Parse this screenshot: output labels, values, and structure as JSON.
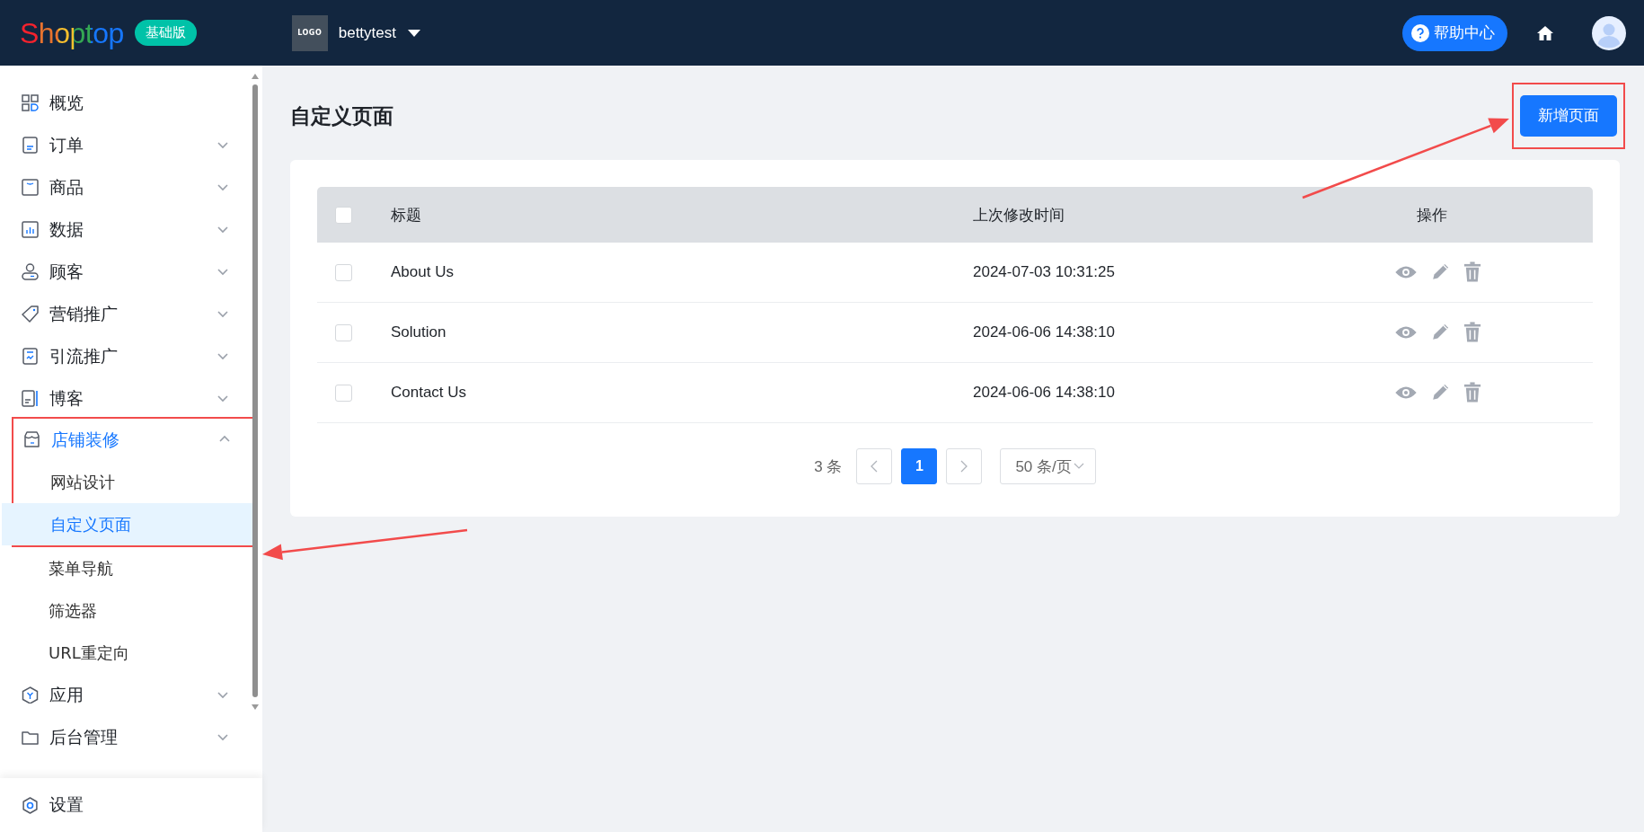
{
  "header": {
    "brand": "Shoptop",
    "plan_badge": "基础版",
    "store": {
      "logo_text": "LOGO",
      "name": "bettytest"
    },
    "help_button": "帮助中心"
  },
  "sidebar": {
    "items": [
      {
        "label": "概览",
        "kind": "link",
        "selected": false
      },
      {
        "label": "订单",
        "kind": "group",
        "expanded": false,
        "selected": false
      },
      {
        "label": "商品",
        "kind": "group",
        "expanded": false,
        "selected": false
      },
      {
        "label": "数据",
        "kind": "group",
        "expanded": false,
        "selected": false
      },
      {
        "label": "顾客",
        "kind": "group",
        "expanded": false,
        "selected": false
      },
      {
        "label": "营销推广",
        "kind": "group",
        "expanded": false,
        "selected": false
      },
      {
        "label": "引流推广",
        "kind": "group",
        "expanded": false,
        "selected": false
      },
      {
        "label": "博客",
        "kind": "group",
        "expanded": false,
        "selected": false
      },
      {
        "label": "店铺装修",
        "kind": "group",
        "expanded": true,
        "selected": true,
        "highlighted": true,
        "children": [
          {
            "label": "网站设计",
            "selected": false
          },
          {
            "label": "自定义页面",
            "selected": true
          },
          {
            "label": "菜单导航",
            "selected": false
          },
          {
            "label": "筛选器",
            "selected": false
          },
          {
            "label": "URL重定向",
            "selected": false
          }
        ]
      },
      {
        "label": "应用",
        "kind": "group",
        "expanded": false,
        "selected": false
      },
      {
        "label": "后台管理",
        "kind": "group",
        "expanded": false,
        "selected": false
      }
    ],
    "footer_item": "设置"
  },
  "page": {
    "title": "自定义页面",
    "new_button": {
      "label": "新增页面",
      "highlighted": true
    },
    "table": {
      "select_all_checked": false,
      "columns": [
        "标题",
        "上次修改时间",
        "操作"
      ],
      "rows": [
        {
          "checked": false,
          "title": "About Us",
          "modified": "2024-07-03 10:31:25"
        },
        {
          "checked": false,
          "title": "Solution",
          "modified": "2024-06-06 14:38:10"
        },
        {
          "checked": false,
          "title": "Contact Us",
          "modified": "2024-06-06 14:38:10"
        }
      ]
    },
    "pagination": {
      "total": "3 条",
      "pages": [
        {
          "label": "1",
          "selected": true
        }
      ],
      "page_size": "50 条/页"
    }
  }
}
